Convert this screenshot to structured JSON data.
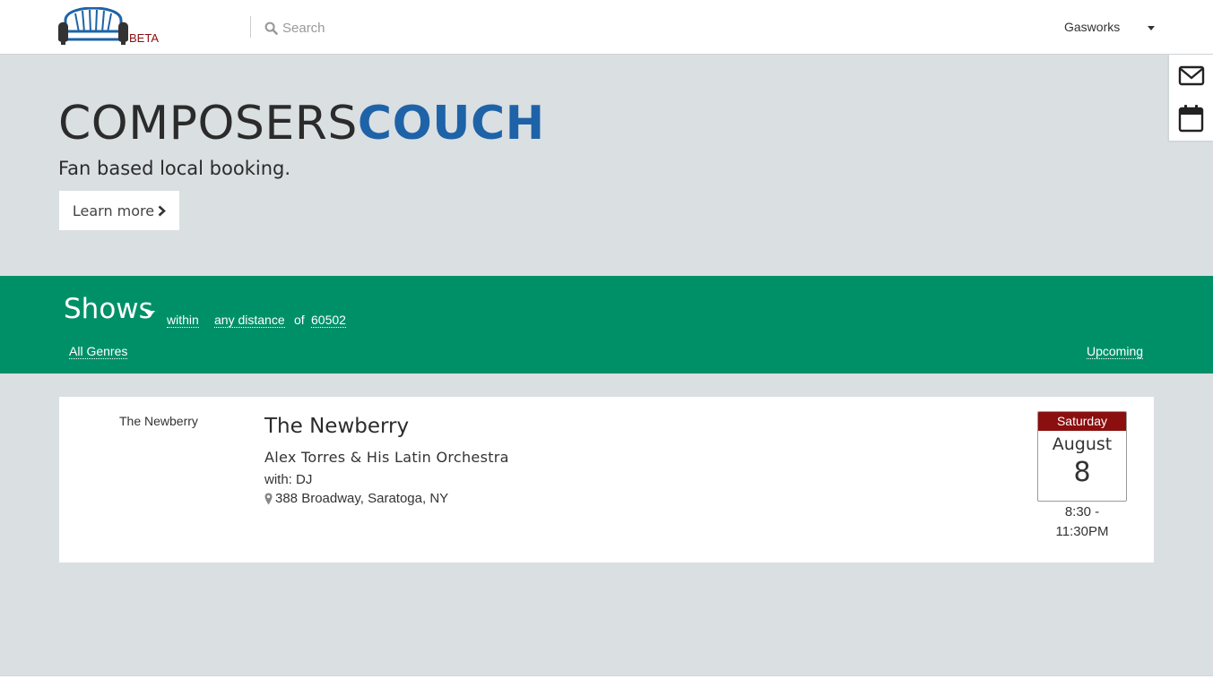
{
  "nav": {
    "beta_label": "BETA",
    "search_placeholder": "Search",
    "venue_selected": "Gasworks"
  },
  "hero": {
    "title_main": "COMPOSERS",
    "title_accent": "COUCH",
    "tagline": "Fan based local booking.",
    "learn_more_label": "Learn more"
  },
  "filters": {
    "category": "Shows",
    "within_label": "within",
    "distance": "any distance",
    "of_label": "of",
    "zip": "60502",
    "genres": "All Genres",
    "timeframe": "Upcoming"
  },
  "events": [
    {
      "venue_thumb": "The Newberry",
      "title": "The Newberry",
      "artist": "Alex Torres & His Latin Orchestra",
      "with": "with: DJ",
      "address": "388 Broadway, Saratoga, NY",
      "day_of_week": "Saturday",
      "month": "August",
      "day": "8",
      "time_start": "8:30 -",
      "time_end": "11:30PM"
    }
  ],
  "colors": {
    "brand_blue": "#1e63a8",
    "filter_green": "#009068",
    "date_red": "#8b0f0f",
    "background": "#dadfe2"
  },
  "icons": {
    "logo": "couch-logo-icon",
    "search": "search-icon",
    "mail": "envelope-icon",
    "calendar": "calendar-icon",
    "map_marker": "map-marker-icon",
    "chevron": "chevron-right-icon"
  }
}
